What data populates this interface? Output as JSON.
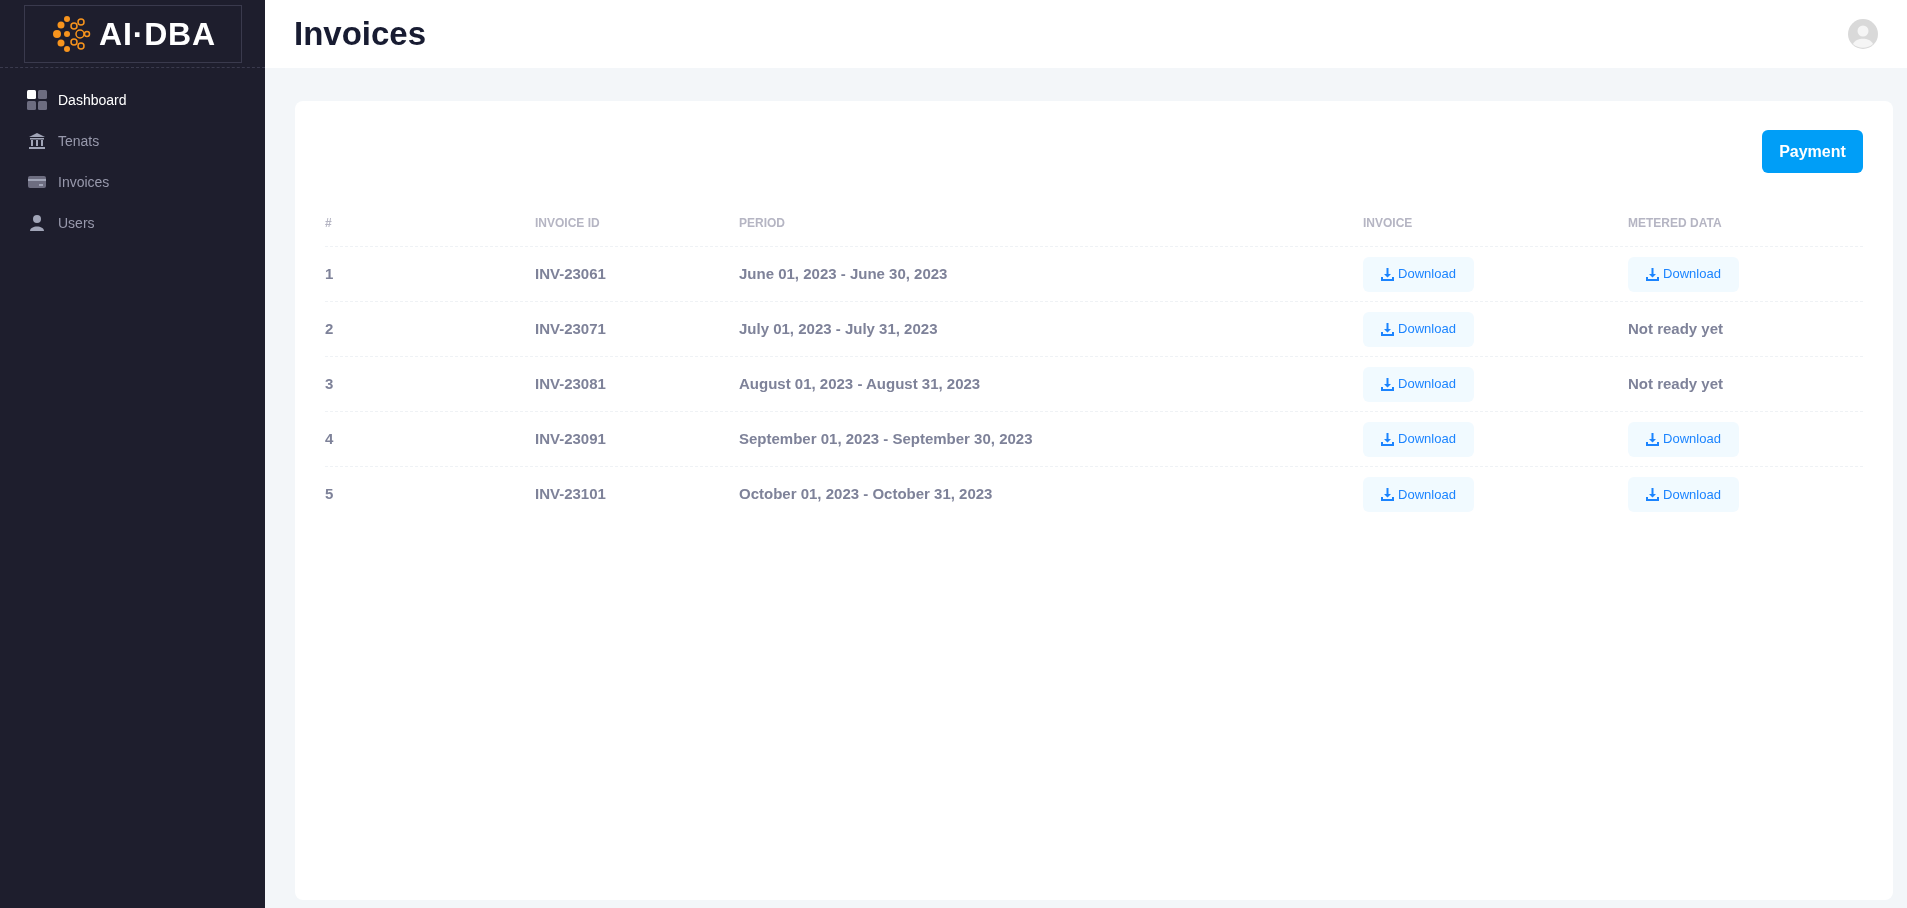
{
  "logo": {
    "text": "AI·DBA"
  },
  "sidebar": {
    "items": [
      {
        "label": "Dashboard",
        "selected": true
      },
      {
        "label": "Tenats",
        "selected": false
      },
      {
        "label": "Invoices",
        "selected": false
      },
      {
        "label": "Users",
        "selected": false
      }
    ]
  },
  "header": {
    "title": "Invoices"
  },
  "payment_button": "Payment",
  "table": {
    "columns": [
      "#",
      "INVOICE ID",
      "PERIOD",
      "INVOICE",
      "METERED DATA"
    ],
    "rows": [
      {
        "number": "1",
        "invoice_id": "INV-23061",
        "period": "June 01, 2023 - June 30, 2023",
        "invoice": {
          "kind": "download",
          "label": "Download"
        },
        "metered": {
          "kind": "download",
          "label": "Download"
        }
      },
      {
        "number": "2",
        "invoice_id": "INV-23071",
        "period": "July 01, 2023 - July 31, 2023",
        "invoice": {
          "kind": "download",
          "label": "Download"
        },
        "metered": {
          "kind": "text",
          "label": "Not ready yet"
        }
      },
      {
        "number": "3",
        "invoice_id": "INV-23081",
        "period": "August 01, 2023 - August 31, 2023",
        "invoice": {
          "kind": "download",
          "label": "Download"
        },
        "metered": {
          "kind": "text",
          "label": "Not ready yet"
        }
      },
      {
        "number": "4",
        "invoice_id": "INV-23091",
        "period": "September 01, 2023 - September 30, 2023",
        "invoice": {
          "kind": "download",
          "label": "Download"
        },
        "metered": {
          "kind": "download",
          "label": "Download"
        }
      },
      {
        "number": "5",
        "invoice_id": "INV-23101",
        "period": "October 01, 2023 - October 31, 2023",
        "invoice": {
          "kind": "download",
          "label": "Download"
        },
        "metered": {
          "kind": "download",
          "label": "Download"
        }
      }
    ]
  }
}
